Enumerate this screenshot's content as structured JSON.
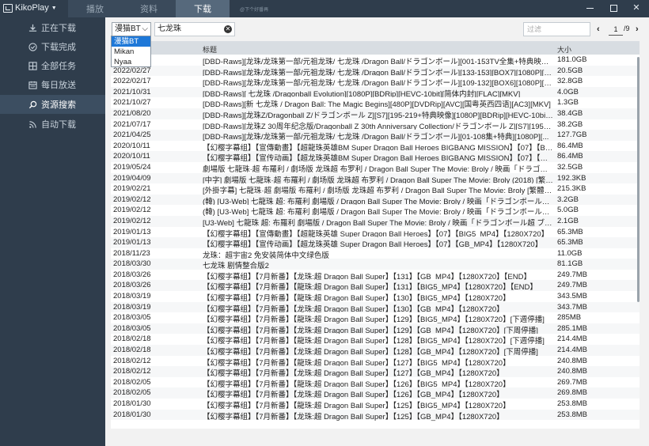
{
  "app": {
    "title": "KikoPlay",
    "tagline": "@下个好番再"
  },
  "tabs": {
    "play": "播放",
    "library": "资料",
    "download": "下载"
  },
  "sidebar": {
    "items": [
      {
        "label": "正在下载",
        "icon": "download-icon"
      },
      {
        "label": "下载完成",
        "icon": "check-circle-icon"
      },
      {
        "label": "全部任务",
        "icon": "grid-icon"
      },
      {
        "label": "每日放送",
        "icon": "calendar-icon"
      },
      {
        "label": "资源搜索",
        "icon": "search-icon",
        "active": true
      },
      {
        "label": "自动下载",
        "icon": "rss-icon"
      }
    ]
  },
  "search": {
    "source": "漫猫BT",
    "keyword": "七龙珠",
    "filter_placeholder": "过滤",
    "page": "1",
    "total_pages": "/9"
  },
  "dropdown": {
    "options": [
      "漫猫BT",
      "Mikan",
      "Nyaa"
    ],
    "selected": "漫猫BT"
  },
  "table": {
    "headers": {
      "title": "标题",
      "size": "大小"
    },
    "rows": [
      {
        "date": "",
        "title": "[DBD-Raws][龙珠/龙珠第一部/元祖龙珠/ 七龙珠 /Dragon Ball/ドラゴンボール][001-153TV全集+特典映像][108...",
        "size": "181.0GB"
      },
      {
        "date": "2022/02/27",
        "title": "[DBD-Raws][龙珠/龙珠第一部/元祖龙珠/ 七龙珠 /Dragon Ball/ドラゴンボール][133-153][BOX7][1080P][BDRip...",
        "size": "20.5GB"
      },
      {
        "date": "2022/02/17",
        "title": "[DBD-Raws][龙珠/龙珠第一部/元祖龙珠/ 七龙珠 /Dragon Ball/ドラゴンボール][109-132][BOX6][1080P][BDRip...",
        "size": "32.8GB"
      },
      {
        "date": "2021/10/31",
        "title": "[DBD-Raws][ 七龙珠 /Dragonball Evolution][1080P][BDRip][HEVC-10bit][简体内封][FLAC][MKV]",
        "size": "4.0GB"
      },
      {
        "date": "2021/10/27",
        "title": "[DBD-Raws][新 七龙珠 / Dragon Ball: The Magic Begins][480P][DVDRip][AVC][国粤英西四语][AC3][MKV]",
        "size": "1.3GB"
      },
      {
        "date": "2021/08/20",
        "title": "[DBD-Raws][龙珠Z/Dragonball Z/ドラゴンボール Z][S7][195-219+特典映像][1080P][BDRip][HEVC-10bit][AC3...",
        "size": "38.4GB"
      },
      {
        "date": "2021/07/17",
        "title": "[DBD-Raws][龙珠Z 30周年纪念版/Dragonball Z 30th Anniversary Collection/ドラゴンボール Z][S7][195-219+...",
        "size": "38.2GB"
      },
      {
        "date": "2021/04/25",
        "title": "[DBD-Raws][龙珠/龙珠第一部/元祖龙珠/ 七龙珠 /Dragon Ball/ドラゴンボール][01-108集+特典][1080P][...",
        "size": "127.7GB"
      },
      {
        "date": "2020/10/11",
        "title": "【幻樱字幕组】【宣傳動畫】【超龍珠英雄BM Super Dragon Ball Heroes BIGBANG MISSION】【07】【BIG5_...",
        "size": "86.4MB"
      },
      {
        "date": "2020/10/11",
        "title": "【幻樱字幕组】【宣传动画】【超龙珠英雄BM Super Dragon Ball Heroes BIGBANG MISSION】【07】【GB_M...",
        "size": "86.4MB"
      },
      {
        "date": "2019/05/24",
        "title": "劇場版 七龍珠·超 布羅利 / 劇场版 龙珠超 布罗利 / Dragon Ball Super The Movie: Broly / 映画「ドラゴンボー...",
        "size": "32.5GB"
      },
      {
        "date": "2019/04/09",
        "title": "[中字] 劇場版 七龍珠·超 布羅利 / 劇场版 龙珠超 布罗利 / Dragon Ball Super The Movie: Broly (2018) [繁體中文...",
        "size": "192.3KB"
      },
      {
        "date": "2019/02/21",
        "title": "[外掛字幕] 七龍珠·超 劇場版 布羅利 / 劇场版 龙珠超 布罗利 / Dragon Ball Super The Movie: Broly [繁體中文外...",
        "size": "215.3KB"
      },
      {
        "date": "2019/02/12",
        "title": "(韓) [U3-Web] 七龍珠 超: 布羅利 劇場版 / Dragon Ball Super The Movie: Broly / 映画「ドラゴンボール超 ブロ...",
        "size": "3.2GB"
      },
      {
        "date": "2019/02/12",
        "title": "(韓) [U3-Web] 七龍珠 超: 布羅利 劇場版 / Dragon Ball Super The Movie: Broly / 映画「ドラゴンボール超 ブロ...",
        "size": "5.0GB"
      },
      {
        "date": "2019/02/12",
        "title": "[U3-Web] 七龍珠 超: 布羅利 劇場版 / Dragon Ball Super The Movie: Broly / 映画「ドラゴンボール超 ブロリー...",
        "size": "2.1GB"
      },
      {
        "date": "2019/01/13",
        "title": "【幻樱字幕组】【宣傳動畫】【超龍珠英雄 Super Dragon Ball Heroes】【07】【BIG5_MP4】【1280X720】",
        "size": "65.3MB"
      },
      {
        "date": "2019/01/13",
        "title": "【幻樱字幕组】【宣传动画】【超龙珠英雄 Super Dragon Ball Heroes】【07】【GB_MP4】【1280X720】",
        "size": "65.3MB"
      },
      {
        "date": "2018/11/23",
        "title": "龙珠：超宇宙2 免安装简体中文绿色版",
        "size": "11.0GB"
      },
      {
        "date": "2018/03/30",
        "title": "七龙珠 剧情整合版2",
        "size": "81.1GB"
      },
      {
        "date": "2018/03/26",
        "title": "【幻樱字幕组】【7月新番】【龙珠:超 Dragon Ball Super】【131】【GB_MP4】【1280X720】【END】",
        "size": "249.7MB"
      },
      {
        "date": "2018/03/26",
        "title": "【幻樱字幕组】【7月新番】【龍珠:超 Dragon Ball Super】【131】【BIG5_MP4】【1280X720】【END】",
        "size": "249.7MB"
      },
      {
        "date": "2018/03/19",
        "title": "【幻樱字幕组】【7月新番】【龍珠:超 Dragon Ball Super】【130】【BIG5_MP4】【1280X720】",
        "size": "343.5MB"
      },
      {
        "date": "2018/03/19",
        "title": "【幻樱字幕组】【7月新番】【龙珠:超 Dragon Ball Super】【130】【GB_MP4】【1280X720】",
        "size": "343.7MB"
      },
      {
        "date": "2018/03/05",
        "title": "【幻樱字幕组】【7月新番】【龍珠:超 Dragon Ball Super】【129】【BIG5_MP4】【1280X720】[下週停播]",
        "size": "285MB"
      },
      {
        "date": "2018/03/05",
        "title": "【幻樱字幕组】【7月新番】【龙珠:超 Dragon Ball Super】【129】【GB_MP4】【1280X720】[下周停播]",
        "size": "285.1MB"
      },
      {
        "date": "2018/02/18",
        "title": "【幻樱字幕组】【7月新番】【龍珠:超 Dragon Ball Super】【128】【BIG5_MP4】【1280X720】[下週停播]",
        "size": "214.4MB"
      },
      {
        "date": "2018/02/18",
        "title": "【幻樱字幕组】【7月新番】【龙珠:超 Dragon Ball Super】【128】【GB_MP4】【1280X720】[下周停播]",
        "size": "214.4MB"
      },
      {
        "date": "2018/02/12",
        "title": "【幻樱字幕组】【7月新番】【龍珠:超 Dragon Ball Super】【127】【BIG5_MP4】【1280X720】",
        "size": "240.8MB"
      },
      {
        "date": "2018/02/12",
        "title": "【幻樱字幕组】【7月新番】【龙珠:超 Dragon Ball Super】【127】【GB_MP4】【1280X720】",
        "size": "240.8MB"
      },
      {
        "date": "2018/02/05",
        "title": "【幻樱字幕组】【7月新番】【龍珠:超 Dragon Ball Super】【126】【BIG5_MP4】【1280X720】",
        "size": "269.7MB"
      },
      {
        "date": "2018/02/05",
        "title": "【幻樱字幕组】【7月新番】【龙珠:超 Dragon Ball Super】【126】【GB_MP4】【1280X720】",
        "size": "269.8MB"
      },
      {
        "date": "2018/01/30",
        "title": "【幻樱字幕组】【7月新番】【龍珠:超 Dragon Ball Super】【125】【BIG5_MP4】【1280X720】",
        "size": "253.8MB"
      },
      {
        "date": "2018/01/30",
        "title": "【幻樱字幕组】【7月新番】【龙珠:超 Dragon Ball Super】【125】【GB_MP4】【1280X720】",
        "size": "253.8MB"
      }
    ]
  },
  "colors": {
    "sidebar_bg": "#2f3d4c",
    "active_tab": "#56697c",
    "selection": "#1e78d8"
  }
}
